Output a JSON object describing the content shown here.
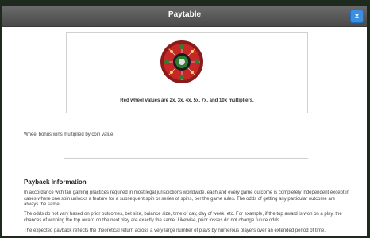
{
  "dialog": {
    "title": "Paytable",
    "close_label": "x"
  },
  "wheel": {
    "caption": "Red wheel values are 2x, 3x, 4x, 5x, 7x, and 10x multipliers."
  },
  "notes": {
    "wheel_bonus": "Wheel bonus wins multiplied by coin value."
  },
  "payback": {
    "heading": "Payback Information",
    "p1": "In accordance with fair gaming practices required in most legal jurisdictions worldwide, each and every game outcome is completely independent except in cases where one spin unlocks a feature for a subsequent spin or series of spins, per the game rules. The odds of getting any particular outcome are always the same.",
    "p2": "The odds do not vary based on prior outcomes, bet size, balance size, time of day, day of week, etc. For example, if the top award is won on a play, the chances of winning the top award on the next play are exactly the same. Likewise, prior losses do not change future odds.",
    "p3": "The expected payback reflects the theoretical return across a very large number of plays by numerous players over an extended period of time."
  },
  "colors": {
    "titlebar": "#555555",
    "close_button": "#3b8ee0",
    "wheel_red": "#c62828",
    "wheel_green": "#2e7d32"
  }
}
